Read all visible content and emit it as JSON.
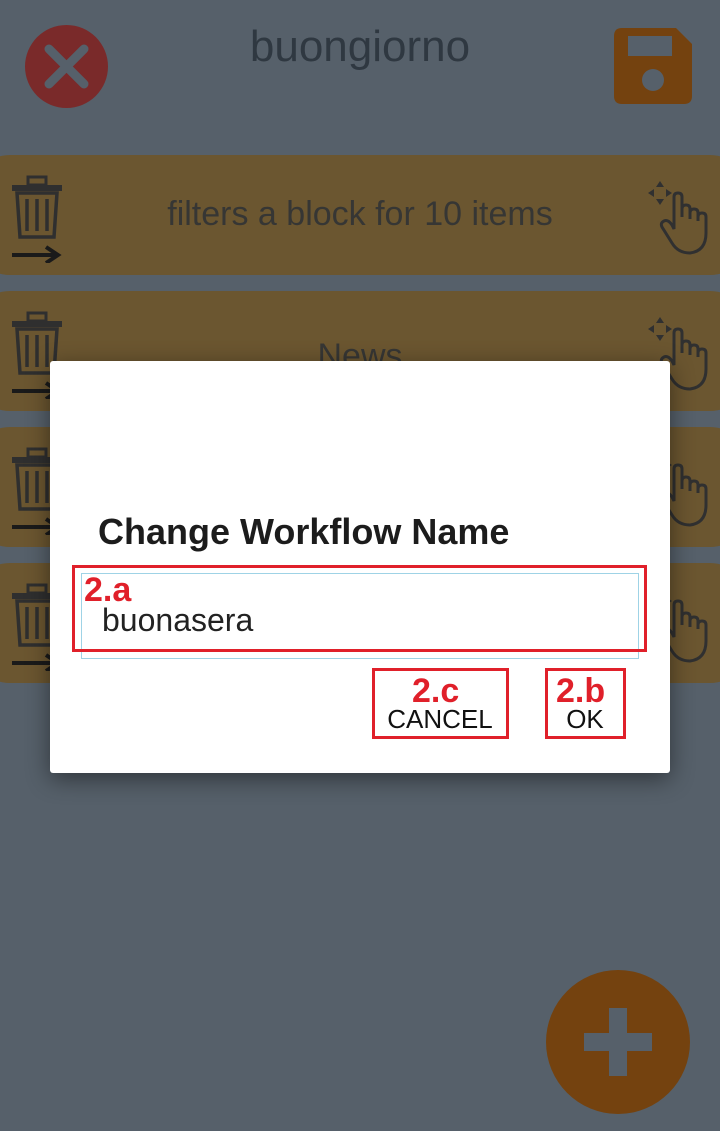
{
  "header": {
    "title": "buongiorno",
    "close_icon": "close-icon",
    "save_icon": "floppy-disk-icon"
  },
  "rows": [
    {
      "label": "filters a block for 10 items"
    },
    {
      "label": "News"
    },
    {
      "label": ""
    },
    {
      "label": ""
    }
  ],
  "dialog": {
    "title": "Change Workflow Name",
    "input_value": "buonasera",
    "cancel_label": "CANCEL",
    "ok_label": "OK"
  },
  "annotations": {
    "input": "2.a",
    "ok": "2.b",
    "cancel": "2.c"
  },
  "fab": {
    "icon": "plus-icon"
  },
  "colors": {
    "background": "#56606a",
    "row": "#6b5630",
    "close": "#7a2a2a",
    "accent": "#74420f",
    "annotation": "#e0202a"
  }
}
